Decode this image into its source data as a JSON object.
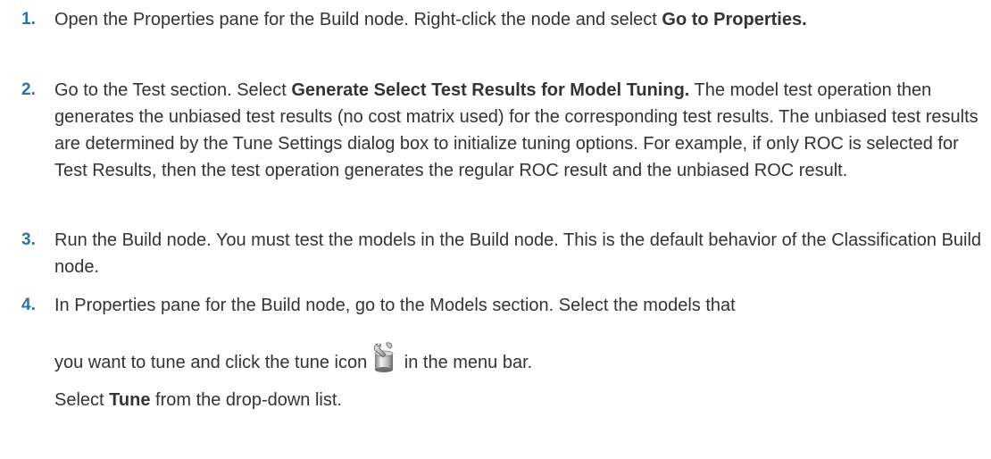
{
  "steps": [
    {
      "number": "1.",
      "before": "Open the Properties pane for the Build node. Right-click the node and select ",
      "bold": "Go to Properties."
    },
    {
      "number": "2.",
      "before": "Go to the Test section. Select ",
      "bold": "Generate Select Test Results for Model Tuning.",
      "after": " The model test operation then generates the unbiased test results (no cost matrix used) for the corresponding test results. The unbiased test results are determined by the Tune Settings dialog box to initialize tuning options. For example, if only ROC is selected for Test Results, then the test operation generates the regular ROC result and the unbiased ROC result."
    },
    {
      "number": "3.",
      "text": "Run the Build node. You must test the models in the Build node. This is the default behavior of the Classification Build node."
    },
    {
      "number": "4.",
      "line1": "In Properties pane for the Build node, go to the Models section. Select the models that",
      "line2_before": "you want to tune and click the tune icon",
      "line2_after": " in the menu bar.",
      "icon": "tune-icon",
      "line3_before": "Select ",
      "line3_bold": "Tune",
      "line3_after": " from the drop-down list."
    }
  ],
  "colors": {
    "number": "#2f6fb0",
    "text": "#333333"
  }
}
